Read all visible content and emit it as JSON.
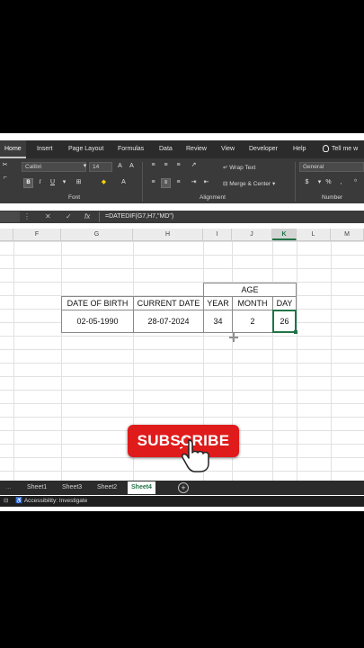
{
  "ribbon_tabs": [
    "Home",
    "Insert",
    "Page Layout",
    "Formulas",
    "Data",
    "Review",
    "View",
    "Developer",
    "Help",
    "Tell me w"
  ],
  "ribbon": {
    "font_name": "Calibri",
    "font_size": "14",
    "wrap_text": "Wrap Text",
    "merge_center": "Merge & Center",
    "number_format": "General",
    "group_font": "Font",
    "group_alignment": "Alignment",
    "group_number": "Number"
  },
  "formula": "=DATEDIF(G7,H7,\"MD\")",
  "columns": [
    "F",
    "G",
    "H",
    "I",
    "J",
    "K",
    "L",
    "M"
  ],
  "selected_column": "K",
  "table": {
    "group_header": "AGE",
    "headers": [
      "DATE OF BIRTH",
      "CURRENT DATE",
      "YEAR",
      "MONTH",
      "DAY"
    ],
    "row": [
      "02-05-1990",
      "28-07-2024",
      "34",
      "2",
      "26"
    ]
  },
  "sheets": [
    "Sheet1",
    "Sheet3",
    "Sheet2",
    "Sheet4"
  ],
  "active_sheet": "Sheet4",
  "status": "Accessibility: Investigate",
  "subscribe_label": "SUBSCRIBE",
  "colors": {
    "excel_green": "#217346",
    "subscribe_red": "#e01b1b"
  }
}
